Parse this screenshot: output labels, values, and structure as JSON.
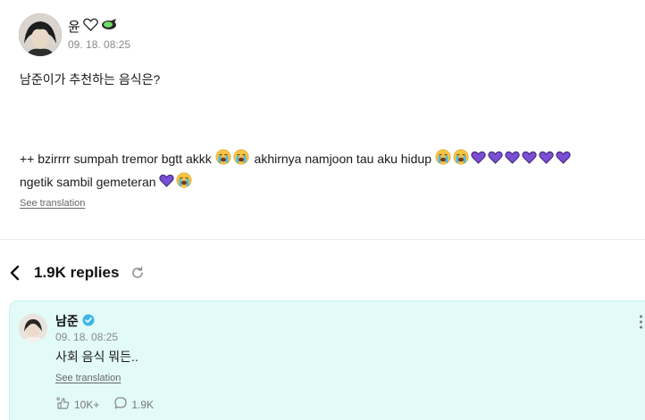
{
  "post": {
    "username": "윤",
    "username_icons": [
      "white-heart-icon",
      "lime-rocket-icon"
    ],
    "timestamp": "09. 18. 08:25",
    "question": "남준이가 추천하는 음식은?",
    "body_line1": "++ bzirrrr sumpah tremor bgtt akkk",
    "body_line1b": "akhirnya namjoon tau aku hidup",
    "body_line2": "ngetik sambil gemeteran",
    "translate_label": "See translation"
  },
  "replies": {
    "count_label": "1.9K replies"
  },
  "reply": {
    "username": "남준",
    "verified": true,
    "timestamp": "09. 18. 08:25",
    "text": "사회 음식 뭐든..",
    "translate_label": "See translation",
    "reactions": "10K+",
    "comments": "1.9K"
  },
  "colors": {
    "reply_background": "#e2fbf8",
    "verified_badge": "#3fb6e8",
    "heart_purple": "#7a4fd6"
  }
}
